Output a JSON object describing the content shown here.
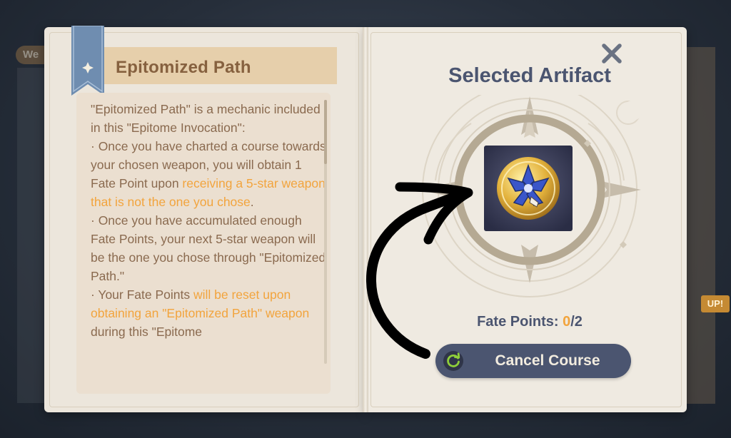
{
  "background": {
    "left_tab_label": "We",
    "right_badge_label": "UP!"
  },
  "left_page": {
    "title": "Epitomized Path",
    "intro": "\"Epitomized Path\" is a mechanic included in this \"Epitome Invocation\":",
    "bullet1_pre": "· Once you have charted a course towards your chosen weapon, you will obtain 1 Fate Point upon ",
    "bullet1_highlight": "receiving a 5-star weapon that is not the one you chose",
    "bullet1_post": ".",
    "bullet2": "· Once you have accumulated enough Fate Points, your next 5-star weapon will be the one you chose through \"Epitomized Path.\"",
    "bullet3_pre": "· Your Fate Points ",
    "bullet3_highlight": "will be reset upon obtaining an \"Epitomized Path\" weapon",
    "bullet3_post": " during this \"Epitome"
  },
  "right_page": {
    "title": "Selected Artifact",
    "fate_label": "Fate Points: ",
    "fate_current": "0",
    "fate_total": "/2",
    "cancel_label": "Cancel Course"
  },
  "icons": {
    "close": "close-icon",
    "refresh": "refresh-icon",
    "bookmark": "bookmark-star-icon",
    "artifact": "blue-flower-artifact-icon"
  },
  "colors": {
    "accent": "#f2a43d",
    "title_brown": "#86613f",
    "slate": "#4b5570",
    "page": "#ece6dc"
  }
}
